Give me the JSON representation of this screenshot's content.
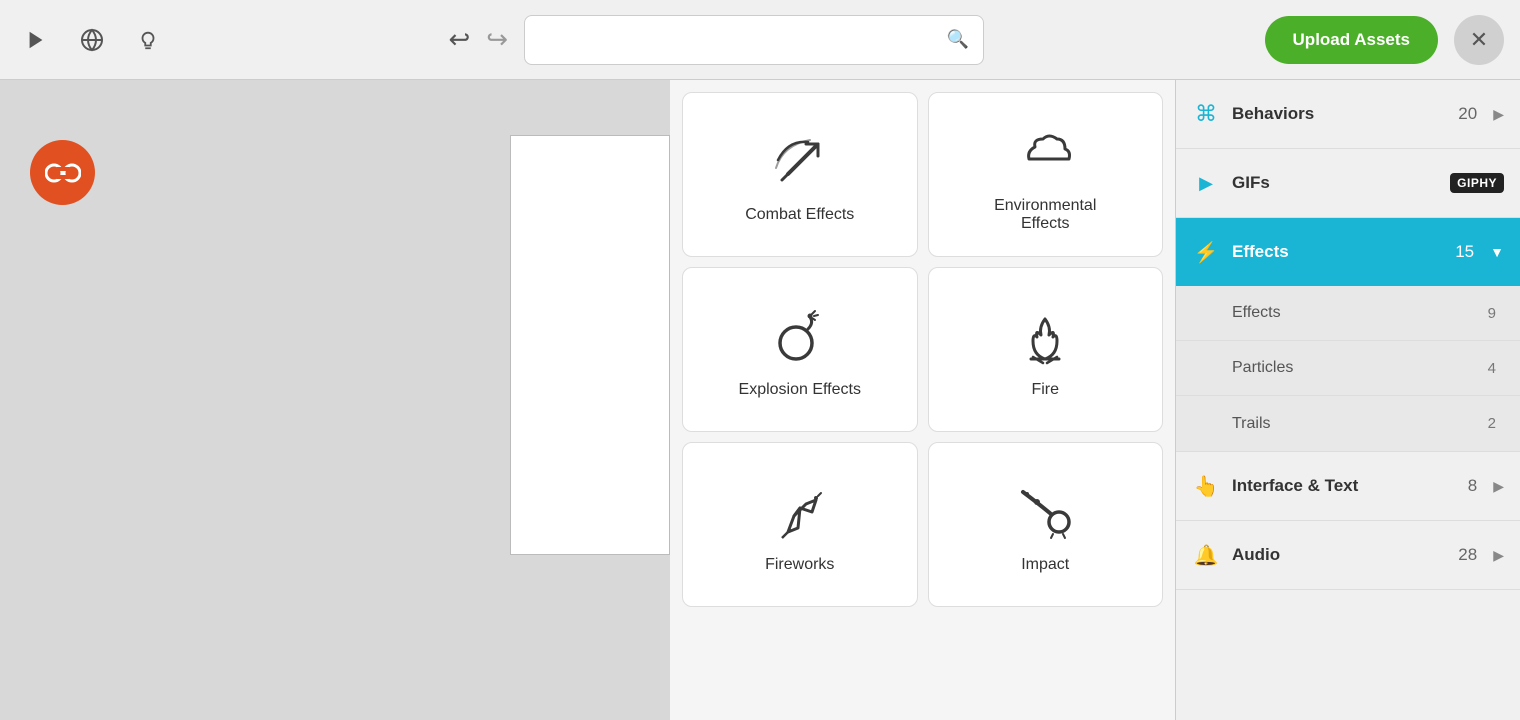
{
  "topbar": {
    "play_label": "▶",
    "globe_label": "🌐",
    "light_label": "💡",
    "undo_label": "↩",
    "redo_label": "↪",
    "search_placeholder": "",
    "upload_label": "Upload Assets",
    "close_label": "✕"
  },
  "grid": {
    "cards": [
      {
        "id": "combat-effects",
        "label": "Combat Effects",
        "icon": "combat"
      },
      {
        "id": "environmental-effects",
        "label": "Environmental Effects",
        "icon": "cloud"
      },
      {
        "id": "explosion-effects",
        "label": "Explosion Effects",
        "icon": "bomb"
      },
      {
        "id": "fire",
        "label": "Fire",
        "icon": "fire"
      },
      {
        "id": "fireworks",
        "label": "Fireworks",
        "icon": "fireworks"
      },
      {
        "id": "impact",
        "label": "Impact",
        "icon": "meteor"
      },
      {
        "id": "extra1",
        "label": "",
        "icon": ""
      },
      {
        "id": "extra2",
        "label": "",
        "icon": ""
      }
    ]
  },
  "sidebar": {
    "sections": [
      {
        "id": "behaviors",
        "icon": "⌘",
        "label": "Behaviors",
        "count": "20",
        "has_arrow": true,
        "active": false,
        "sub_items": []
      },
      {
        "id": "gifs",
        "icon": "▶",
        "label": "GIFs",
        "count": "",
        "has_arrow": false,
        "active": false,
        "badge": "GIPHY",
        "sub_items": []
      },
      {
        "id": "effects",
        "icon": "⚡",
        "label": "Effects",
        "count": "15",
        "has_arrow": true,
        "active": true,
        "sub_items": [
          {
            "label": "Effects",
            "count": "9"
          },
          {
            "label": "Particles",
            "count": "4"
          },
          {
            "label": "Trails",
            "count": "2"
          }
        ]
      },
      {
        "id": "interface-text",
        "icon": "👆",
        "label": "Interface & Text",
        "count": "8",
        "has_arrow": true,
        "active": false,
        "sub_items": []
      },
      {
        "id": "audio",
        "icon": "🔔",
        "label": "Audio",
        "count": "28",
        "has_arrow": true,
        "active": false,
        "sub_items": []
      }
    ]
  }
}
